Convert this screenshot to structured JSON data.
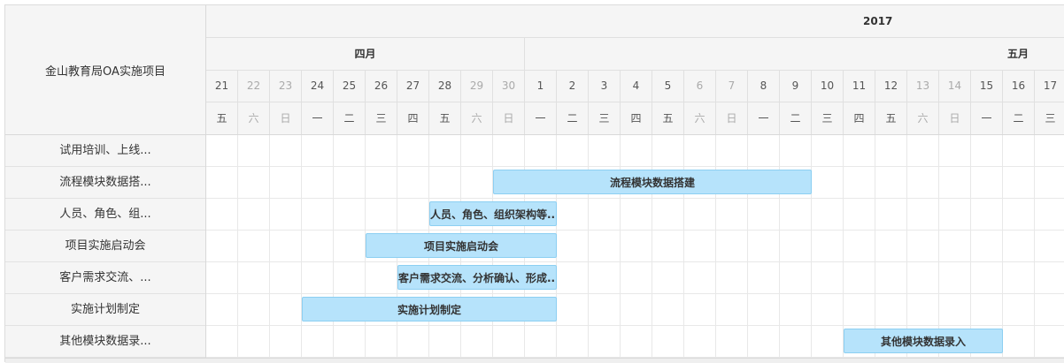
{
  "project_title": "金山教育局OA实施项目",
  "year_label": "2017",
  "months": [
    "四月",
    "五月"
  ],
  "days": [
    {
      "d": "21",
      "w": "五"
    },
    {
      "d": "22",
      "w": "六"
    },
    {
      "d": "23",
      "w": "日"
    },
    {
      "d": "24",
      "w": "一"
    },
    {
      "d": "25",
      "w": "二"
    },
    {
      "d": "26",
      "w": "三"
    },
    {
      "d": "27",
      "w": "四"
    },
    {
      "d": "28",
      "w": "五"
    },
    {
      "d": "29",
      "w": "六"
    },
    {
      "d": "30",
      "w": "日"
    },
    {
      "d": "1",
      "w": "一"
    },
    {
      "d": "2",
      "w": "二"
    },
    {
      "d": "3",
      "w": "三"
    },
    {
      "d": "4",
      "w": "四"
    },
    {
      "d": "5",
      "w": "五"
    },
    {
      "d": "6",
      "w": "六"
    },
    {
      "d": "7",
      "w": "日"
    },
    {
      "d": "8",
      "w": "一"
    },
    {
      "d": "9",
      "w": "二"
    },
    {
      "d": "10",
      "w": "三"
    },
    {
      "d": "11",
      "w": "四"
    },
    {
      "d": "12",
      "w": "五"
    },
    {
      "d": "13",
      "w": "六"
    },
    {
      "d": "14",
      "w": "日"
    },
    {
      "d": "15",
      "w": "一"
    },
    {
      "d": "16",
      "w": "二"
    },
    {
      "d": "17",
      "w": "三"
    }
  ],
  "tasks": [
    {
      "label": "试用培训、上线...",
      "bar_text": "",
      "start": null,
      "end": null
    },
    {
      "label": "流程模块数据搭...",
      "bar_text": "流程模块数据搭建",
      "start": "2017-04-30",
      "end": "2017-05-09"
    },
    {
      "label": "人员、角色、组...",
      "bar_text": "人员、角色、组织架构等...",
      "start": "2017-04-28",
      "end": "2017-05-01"
    },
    {
      "label": "项目实施启动会",
      "bar_text": "项目实施启动会",
      "start": "2017-04-26",
      "end": "2017-05-01"
    },
    {
      "label": "客户需求交流、...",
      "bar_text": "客户需求交流、分析确认、形成...",
      "start": "2017-04-27",
      "end": "2017-05-01"
    },
    {
      "label": "实施计划制定",
      "bar_text": "实施计划制定",
      "start": "2017-04-24",
      "end": "2017-05-01"
    },
    {
      "label": "其他模块数据录...",
      "bar_text": "其他模块数据录入",
      "start": "2017-05-11",
      "end": "2017-05-15"
    }
  ]
}
